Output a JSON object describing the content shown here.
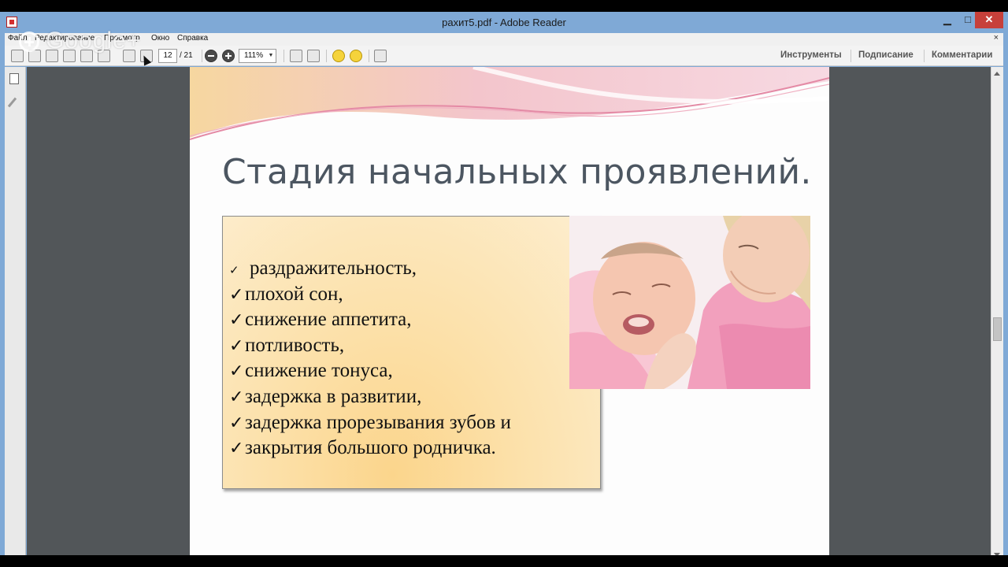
{
  "window": {
    "title": "рахит5.pdf - Adobe Reader",
    "minimize": "▁",
    "maximize": "□",
    "close": "✕"
  },
  "menu": {
    "items": [
      "Файл",
      "Редактирование",
      "Просмотр",
      "Окно",
      "Справка"
    ],
    "close": "×"
  },
  "toolbar": {
    "page_current": "12",
    "page_total": "/ 21",
    "zoom": "111%",
    "links": [
      "Инструменты",
      "Подписание",
      "Комментарии"
    ]
  },
  "overlay": {
    "brand": "Google+"
  },
  "slide": {
    "title": "Стадия начальных проявлений.",
    "items": [
      "раздражительность,",
      "плохой сон,",
      "снижение аппетита,",
      "потливость,",
      "снижение тонуса,",
      "задержка в развитии,",
      "задержка прорезывания зубов и",
      "закрытия большого родничка."
    ],
    "check_mark": "✓"
  },
  "colors": {
    "window_frame": "#7fa9d6",
    "close_button": "#c7403a",
    "doc_background": "#525659",
    "box_gradient_center": "#fbd58c",
    "title_text": "#4c5661"
  }
}
